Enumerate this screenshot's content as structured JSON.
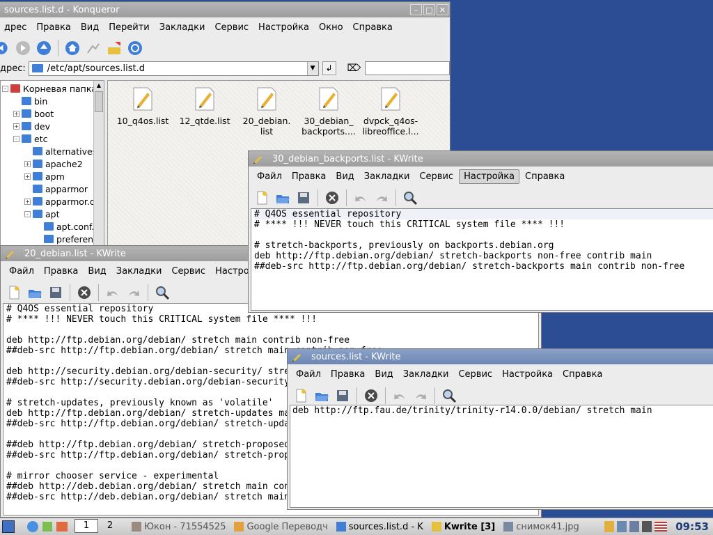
{
  "konqueror": {
    "title": "sources.list.d - Konqueror",
    "menu": [
      "дрес",
      "Правка",
      "Вид",
      "Перейти",
      "Закладки",
      "Сервис",
      "Настройка",
      "Окно",
      "Справка"
    ],
    "address_label": "дрес:",
    "address": "/etc/apt/sources.list.d",
    "search_value": "",
    "tree": [
      {
        "label": "Корневая папка",
        "level": 0,
        "exp": "-"
      },
      {
        "label": "bin",
        "level": 1,
        "exp": ""
      },
      {
        "label": "boot",
        "level": 1,
        "exp": "+"
      },
      {
        "label": "dev",
        "level": 1,
        "exp": "+"
      },
      {
        "label": "etc",
        "level": 1,
        "exp": "-"
      },
      {
        "label": "alternatives",
        "level": 2,
        "exp": ""
      },
      {
        "label": "apache2",
        "level": 2,
        "exp": "+"
      },
      {
        "label": "apm",
        "level": 2,
        "exp": "+"
      },
      {
        "label": "apparmor",
        "level": 2,
        "exp": ""
      },
      {
        "label": "apparmor.d",
        "level": 2,
        "exp": "+"
      },
      {
        "label": "apt",
        "level": 2,
        "exp": "-"
      },
      {
        "label": "apt.conf.d",
        "level": 3,
        "exp": ""
      },
      {
        "label": "preferences",
        "level": 3,
        "exp": ""
      }
    ],
    "files": [
      {
        "line1": "10_q4os.list",
        "line2": ""
      },
      {
        "line1": "12_qtde.list",
        "line2": ""
      },
      {
        "line1": "20_debian.",
        "line2": "list"
      },
      {
        "line1": "30_debian_",
        "line2": "backports...."
      },
      {
        "line1": "dvpck_q4os-",
        "line2": "libreoffice.l..."
      }
    ]
  },
  "kwrite_menu": [
    "Файл",
    "Правка",
    "Вид",
    "Закладки",
    "Сервис",
    "Настройка",
    "Справка"
  ],
  "kwrite_backports": {
    "title": "30_debian_backports.list - KWrite",
    "lines": [
      "# Q4OS essential repository",
      "# **** !!! NEVER touch this CRITICAL system file **** !!!",
      "",
      "# stretch-backports, previously on backports.debian.org",
      "deb http://ftp.debian.org/debian/ stretch-backports non-free contrib main",
      "##deb-src http://ftp.debian.org/debian/ stretch-backports main contrib non-free"
    ]
  },
  "kwrite_debian": {
    "title": "20_debian.list - KWrite",
    "lines": [
      "# Q4OS essential repository",
      "# **** !!! NEVER touch this CRITICAL system file **** !!!",
      "",
      "deb http://ftp.debian.org/debian/ stretch main contrib non-free",
      "##deb-src http://ftp.debian.org/debian/ stretch main contrib non-free",
      "",
      "deb http://security.debian.org/debian-security/ stretch/updates main contrib non-free",
      "##deb-src http://security.debian.org/debian-security/ stretch/updates main contrib non-free",
      "",
      "# stretch-updates, previously known as 'volatile'",
      "deb http://ftp.debian.org/debian/ stretch-updates main contrib non-free",
      "##deb-src http://ftp.debian.org/debian/ stretch-updates main contrib non-free",
      "",
      "##deb http://ftp.debian.org/debian/ stretch-proposed-updates main contrib non-free",
      "##deb-src http://ftp.debian.org/debian/ stretch-proposed-updates main contrib non-free",
      "",
      "# mirror chooser service - experimental",
      "##deb http://deb.debian.org/debian/ stretch main contrib non-free",
      "##deb-src http://deb.debian.org/debian/ stretch main contrib non-free"
    ]
  },
  "kwrite_sources": {
    "title": "sources.list - KWrite",
    "lines": [
      "deb http://ftp.fau.de/trinity/trinity-r14.0.0/debian/ stretch main"
    ]
  },
  "taskbar": {
    "desktops": [
      "1",
      "2"
    ],
    "tasks": [
      "Юкон - 71554525",
      "Google Переводч",
      "sources.list.d - K",
      "Kwrite [3]",
      "снимок41.jpg"
    ],
    "clock": "09:53"
  }
}
